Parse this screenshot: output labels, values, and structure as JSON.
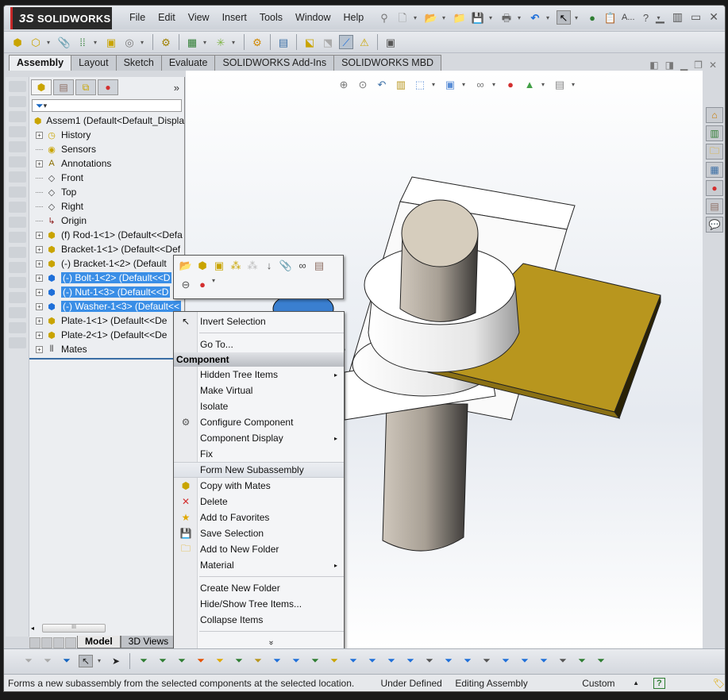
{
  "app": {
    "logo_prefix": "3S",
    "logo_text": "SOLIDWORKS"
  },
  "menu": [
    "File",
    "Edit",
    "View",
    "Insert",
    "Tools",
    "Window",
    "Help"
  ],
  "quick_toolbar": {
    "icons": [
      "pushpin-icon",
      "new-document-icon",
      "open-icon",
      "open-recent-icon",
      "save-icon",
      "print-icon",
      "undo-icon",
      "select-icon",
      "rebuild-icon",
      "file-properties-icon",
      "search-commands-icon",
      "help-icon"
    ],
    "search_text": "A..."
  },
  "command_toolbar": {
    "icons": [
      "insert-components-icon",
      "new-part-icon",
      "mate-icon",
      "linear-pattern-icon",
      "smart-fasteners-icon",
      "move-component-icon",
      "show-hidden-components-icon",
      "assembly-features-icon",
      "reference-geometry-icon",
      "new-motion-study-icon",
      "bill-of-materials-icon",
      "exploded-view-icon",
      "explode-line-sketch-icon",
      "instant3d-icon",
      "update-speedpak-icon",
      "take-snapshot-icon"
    ]
  },
  "command_tabs": [
    "Assembly",
    "Layout",
    "Sketch",
    "Evaluate",
    "SOLIDWORKS Add-Ins",
    "SOLIDWORKS MBD"
  ],
  "active_tab": "Assembly",
  "panel": {
    "tabs": [
      "featuremanager-tab",
      "propertymanager-tab",
      "configurationmanager-tab",
      "displaymanager-tab"
    ],
    "expand_glyph": "»",
    "filter_glyph": "▾",
    "root": "Assem1  (Default<Default_Displa",
    "tree": [
      {
        "label": "History",
        "expandable": true,
        "icon": "history-icon",
        "selected": false
      },
      {
        "label": "Sensors",
        "expandable": false,
        "icon": "sensors-icon",
        "selected": false
      },
      {
        "label": "Annotations",
        "expandable": true,
        "icon": "annotations-icon",
        "selected": false
      },
      {
        "label": "Front",
        "expandable": false,
        "icon": "plane-icon",
        "selected": false
      },
      {
        "label": "Top",
        "expandable": false,
        "icon": "plane-icon",
        "selected": false
      },
      {
        "label": "Right",
        "expandable": false,
        "icon": "plane-icon",
        "selected": false
      },
      {
        "label": "Origin",
        "expandable": false,
        "icon": "origin-icon",
        "selected": false
      },
      {
        "label": "(f) Rod-1<1> (Default<<Defa",
        "expandable": true,
        "icon": "part-icon",
        "selected": false
      },
      {
        "label": "Bracket-1<1> (Default<<Def",
        "expandable": true,
        "icon": "part-icon",
        "selected": false
      },
      {
        "label": "(-) Bracket-1<2> (Default",
        "expandable": true,
        "icon": "part-icon",
        "selected": false
      },
      {
        "label": "(-) Bolt-1<2> (Default<<D",
        "expandable": true,
        "icon": "part-icon",
        "selected": true
      },
      {
        "label": "(-) Nut-1<3> (Default<<D",
        "expandable": true,
        "icon": "part-icon",
        "selected": true
      },
      {
        "label": "(-) Washer-1<3> (Default<<",
        "expandable": true,
        "icon": "part-icon",
        "selected": true
      },
      {
        "label": "Plate-1<1> (Default<<De",
        "expandable": true,
        "icon": "part-icon",
        "selected": false
      },
      {
        "label": "Plate-2<1> (Default<<De",
        "expandable": true,
        "icon": "part-icon",
        "selected": false
      },
      {
        "label": "Mates",
        "expandable": true,
        "icon": "mates-icon",
        "selected": false
      }
    ],
    "bottom_tabs": [
      "Model",
      "3D Views"
    ],
    "scroll_grip": "III"
  },
  "heads_up_toolbar": [
    "zoom-to-fit-icon",
    "zoom-to-area-icon",
    "previous-view-icon",
    "section-view-icon",
    "view-orientation-icon",
    "display-style-icon",
    "hide-show-items-icon",
    "edit-appearance-icon",
    "apply-scene-icon",
    "view-settings-icon"
  ],
  "task_pane": [
    "solidworks-resources-icon",
    "design-library-icon",
    "file-explorer-icon",
    "view-palette-icon",
    "appearances-icon",
    "custom-properties-icon",
    "solidworks-forum-icon"
  ],
  "context_toolbar": {
    "row1": [
      "open-folder-icon",
      "edit-assembly-icon",
      "component-icon",
      "components-icon",
      "hide-components-icon",
      "reorder-icon",
      "attachment-icon",
      "view-mates-icon",
      "properties-icon"
    ],
    "row2": [
      "zoom-to-selection-icon",
      "appearance-icon"
    ]
  },
  "context_menu": {
    "top_items": [
      {
        "label": "Invert Selection",
        "icon": "cursor-icon"
      },
      {
        "label": "Go To...",
        "icon": ""
      }
    ],
    "section_header": "Component",
    "items": [
      {
        "label": "Hidden Tree Items",
        "icon": "",
        "submenu": true
      },
      {
        "label": "Make Virtual",
        "icon": "",
        "submenu": false
      },
      {
        "label": "Isolate",
        "icon": "",
        "submenu": false
      },
      {
        "label": "Configure Component",
        "icon": "configure-component-icon",
        "submenu": false
      },
      {
        "label": "Component Display",
        "icon": "",
        "submenu": true
      },
      {
        "label": "Fix",
        "icon": "",
        "submenu": false
      },
      {
        "label": "Form New Subassembly",
        "icon": "",
        "submenu": false,
        "highlighted": true
      },
      {
        "label": "Copy with Mates",
        "icon": "copy-with-mates-icon",
        "submenu": false
      },
      {
        "label": "Delete",
        "icon": "delete-icon",
        "submenu": false
      },
      {
        "label": "Add to Favorites",
        "icon": "favorites-icon",
        "submenu": false
      },
      {
        "label": "Save Selection",
        "icon": "save-selection-icon",
        "submenu": false
      },
      {
        "label": "Add to New Folder",
        "icon": "folder-icon",
        "submenu": false
      },
      {
        "label": "Material",
        "icon": "",
        "submenu": true
      }
    ],
    "bottom_items": [
      {
        "label": "Create New Folder"
      },
      {
        "label": "Hide/Show Tree Items..."
      },
      {
        "label": "Collapse Items"
      }
    ],
    "more_glyph": "»"
  },
  "selection_filter_toolbar": {
    "count": 32
  },
  "status_bar": {
    "message": "Forms a new subassembly from the selected components at the selected location.",
    "definition": "Under Defined",
    "mode": "Editing Assembly",
    "units": "Custom",
    "units_arrow": "▲",
    "help_glyph": "?"
  },
  "colors": {
    "selection": "#3a8ee6",
    "plate": "#b8961e",
    "bolt": "#b5ada2",
    "accent_red": "#c62828"
  }
}
